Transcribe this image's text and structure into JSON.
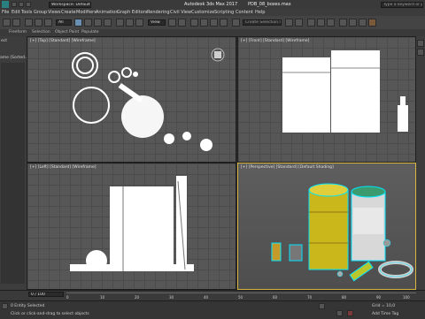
{
  "app": {
    "title": "Autodesk 3ds Max 2017",
    "file": "PDB_08_boxes.max",
    "workspace": "Workspace: Default",
    "search_placeholder": "Type a keyword or phrase"
  },
  "menu": [
    "File",
    "Edit",
    "Tools",
    "Group",
    "Views",
    "Create",
    "Modifiers",
    "Animation",
    "Graph Editors",
    "Rendering",
    "Civil View",
    "Customize",
    "Scripting",
    "Content",
    "Help"
  ],
  "toolbar": {
    "view_dropdown": "View",
    "selection_set_placeholder": "Create Selection Se"
  },
  "ribbon": [
    "Freeform",
    "Selection",
    "Object Paint",
    "Populate"
  ],
  "viewports": {
    "top": "[+] [Top] [Standard] [Wireframe]",
    "front": "[+] [Front] [Standard] [Wireframe]",
    "left": "[+] [Left] [Standard] [Wireframe]",
    "perspective": "[+] [Perspective] [Standard] [Default Shading]"
  },
  "timeline": {
    "frame_counter": "0 / 100",
    "ticks": [
      "0",
      "10",
      "20",
      "30",
      "40",
      "50",
      "60",
      "70",
      "80",
      "90",
      "100"
    ]
  },
  "status": {
    "selection": "0 Entity Selected",
    "prompt": "Click or click-and-drag to select objects",
    "grid": "Grid = 10,0",
    "time_tag": "Add Time Tag"
  },
  "left_panel": {
    "label_top": "ect",
    "label_sorted": "ame (Sorted As"
  },
  "colors": {
    "viewport_bg": "#575757",
    "active_border": "#d8b441",
    "barrel_yellow": "#c9b71b"
  }
}
